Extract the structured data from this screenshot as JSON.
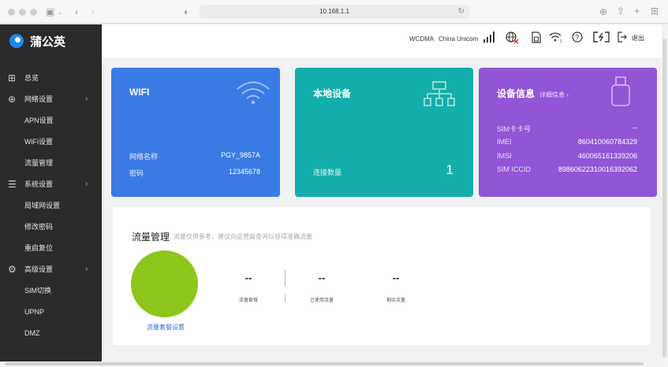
{
  "browser": {
    "url": "10.168.1.1",
    "icons": [
      "sidebar-toggle-icon",
      "chevron-left-icon",
      "chevron-right-icon",
      "shield-icon",
      "reload-icon",
      "download-icon",
      "share-icon",
      "new-tab-icon",
      "tab-overview-icon"
    ]
  },
  "brand": {
    "name": "蒲公英",
    "color": "#1e88e5"
  },
  "sidebar": {
    "items": [
      {
        "label": "总览",
        "icon": "grid-icon",
        "level": 1
      },
      {
        "label": "网络设置",
        "icon": "globe-icon",
        "level": 1,
        "expandable": true
      },
      {
        "label": "APN设置",
        "level": 2
      },
      {
        "label": "WiFi设置",
        "level": 2
      },
      {
        "label": "流量管理",
        "level": 2
      },
      {
        "label": "系统设置",
        "icon": "sliders-icon",
        "level": 1,
        "expandable": true
      },
      {
        "label": "局域网设置",
        "level": 2
      },
      {
        "label": "修改密码",
        "level": 2
      },
      {
        "label": "重启复位",
        "level": 2
      },
      {
        "label": "高级设置",
        "icon": "gear-icon",
        "level": 1,
        "expandable": true
      },
      {
        "label": "SIM切换",
        "level": 2
      },
      {
        "label": "UPNP",
        "level": 2
      },
      {
        "label": "DMZ",
        "level": 2
      }
    ]
  },
  "topbar": {
    "network_type": "WCDMA",
    "carrier": "China Unicom",
    "logout_label": "退出",
    "icons": [
      "signal-icon",
      "globe-disconnected-icon",
      "sim-card-icon",
      "wifi-icon",
      "help-icon",
      "power-icon",
      "logout-icon"
    ]
  },
  "cards": {
    "wifi": {
      "title": "WIFI",
      "color": "#3b7be6",
      "icon": "wifi-icon",
      "ssid_label": "网络名称",
      "ssid": "PGY_9857A",
      "password_label": "密码",
      "password": "12345678"
    },
    "devices": {
      "title": "本地设备",
      "color": "#14aeaa",
      "icon": "network-topology-icon",
      "count_label": "连接数量",
      "count": "1"
    },
    "info": {
      "title": "设备信息",
      "detail_link": "详细信息 ›",
      "color": "#9155d6",
      "icon": "usb-dongle-icon",
      "rows": [
        {
          "label": "SIM卡卡号",
          "value": "--"
        },
        {
          "label": "IMEI",
          "value": "860410060784329"
        },
        {
          "label": "IMSI",
          "value": "460065161339206"
        },
        {
          "label": "SIM ICCID",
          "value": "89860622310016392062"
        }
      ]
    }
  },
  "traffic": {
    "title": "流量管理",
    "note": "流量仅供参考，建议向运营商查询以获得准确流量",
    "pie_color": "#8ec51a",
    "plan_link": "流量套餐设置",
    "stats": [
      {
        "value": "--",
        "label": "流量套餐"
      },
      {
        "value": "--",
        "label": "已使用流量"
      },
      {
        "value": "--",
        "label": "剩余流量"
      }
    ]
  }
}
